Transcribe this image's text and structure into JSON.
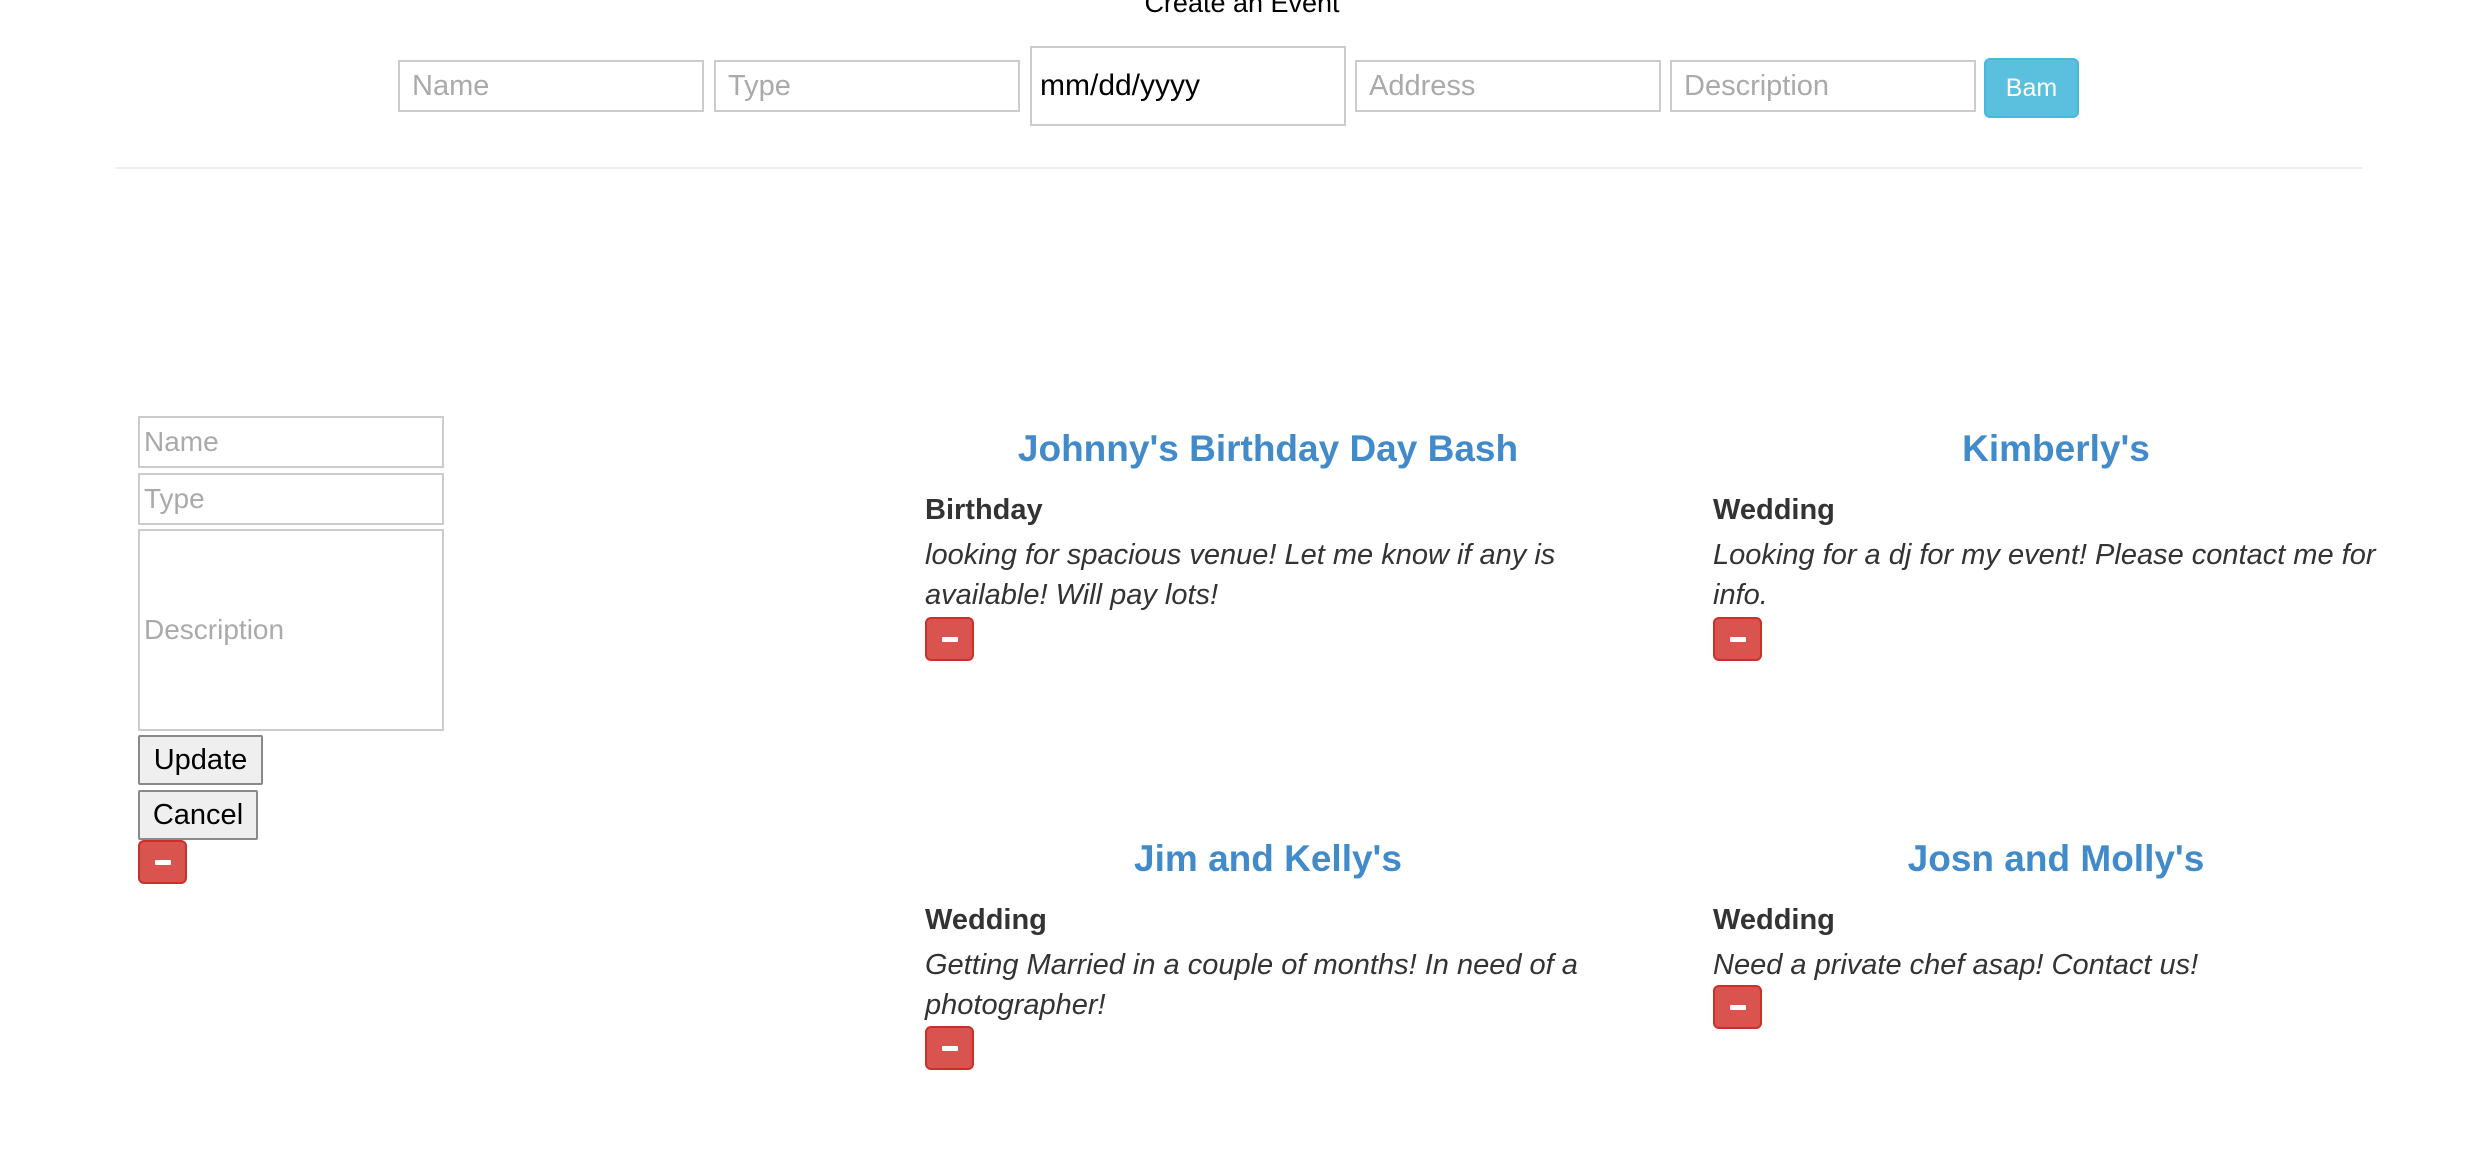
{
  "header": {
    "title": "Create an Event",
    "name_placeholder": "Name",
    "type_placeholder": "Type",
    "date_placeholder": "mm/dd/yyyy",
    "address_placeholder": "Address",
    "description_placeholder": "Description",
    "submit_label": "Bam"
  },
  "edit_form": {
    "name_placeholder": "Name",
    "type_placeholder": "Type",
    "description_placeholder": "Description",
    "update_label": "Update",
    "cancel_label": "Cancel"
  },
  "events": [
    {
      "title": "Johnny's Birthday Day Bash",
      "type": "Birthday",
      "description_line1": "looking for spacious venue! Let me know if any is",
      "description_line2": "available! Will pay lots!"
    },
    {
      "title": "Kimberly's",
      "type": "Wedding",
      "description_line1": "Looking for a dj for my event! Please contact me for",
      "description_line2": "info."
    },
    {
      "title": "Jim and Kelly's",
      "type": "Wedding",
      "description_line1": "Getting Married in a couple of months! In need of a",
      "description_line2": "photographer!"
    },
    {
      "title": "Josn and Molly's",
      "type": "Wedding",
      "description_line1": "Need a private chef asap! Contact us!",
      "description_line2": ""
    }
  ],
  "colors": {
    "primary_blue": "#428bca",
    "info_button": "#5bc0de",
    "danger_button": "#d9534f"
  },
  "icons": {
    "delete": "minus-icon"
  }
}
